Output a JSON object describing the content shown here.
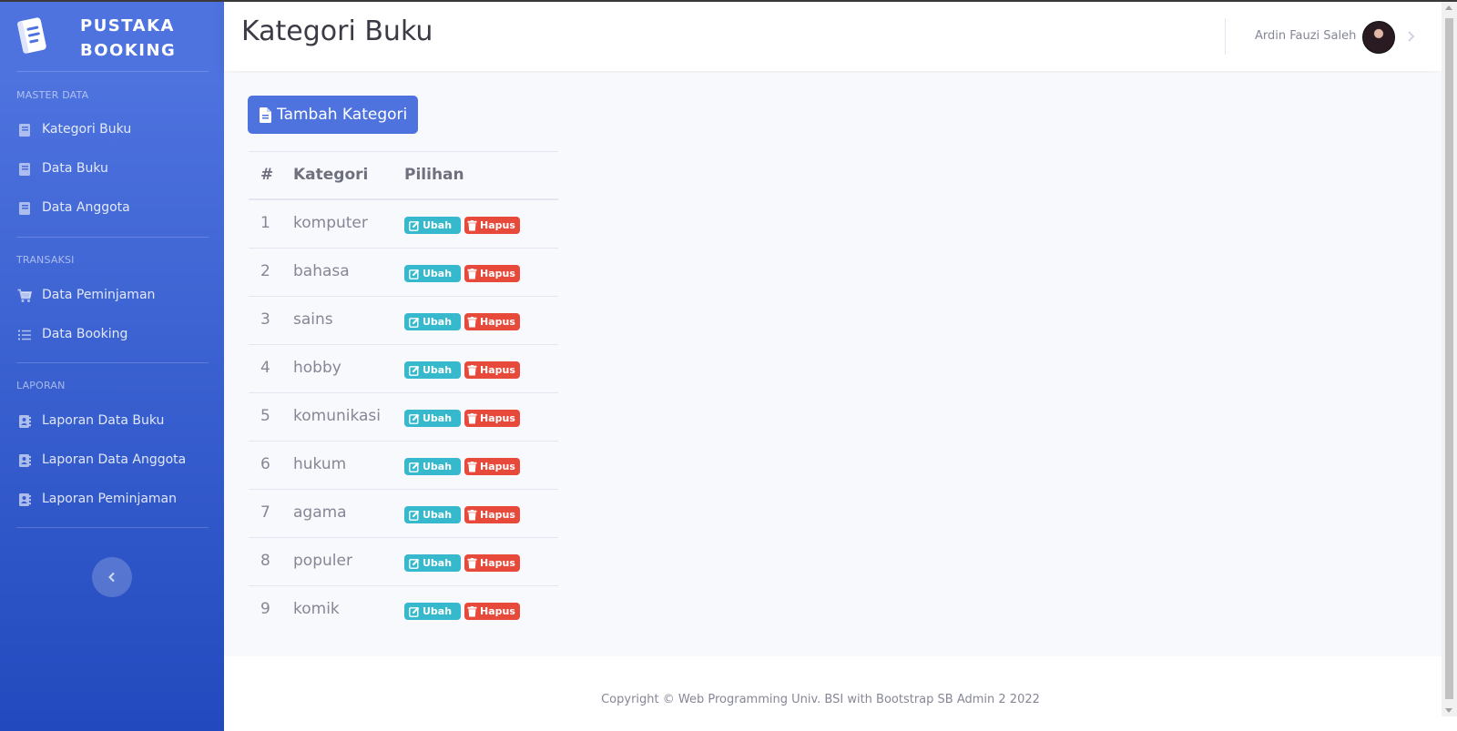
{
  "sidebar": {
    "brand": {
      "line1": "PUSTAKA",
      "line2": "BOOKING",
      "icon": "book-icon"
    },
    "sections": [
      {
        "heading": "MASTER DATA",
        "items": [
          {
            "label": "Kategori Buku",
            "icon": "book-icon"
          },
          {
            "label": "Data Buku",
            "icon": "book-icon"
          },
          {
            "label": "Data Anggota",
            "icon": "book-icon"
          }
        ]
      },
      {
        "heading": "TRANSAKSI",
        "items": [
          {
            "label": "Data Peminjaman",
            "icon": "shopping-cart-icon"
          },
          {
            "label": "Data Booking",
            "icon": "list-icon"
          }
        ]
      },
      {
        "heading": "LAPORAN",
        "items": [
          {
            "label": "Laporan Data Buku",
            "icon": "address-book-icon"
          },
          {
            "label": "Laporan Data Anggota",
            "icon": "address-book-icon"
          },
          {
            "label": "Laporan Peminjaman",
            "icon": "address-book-icon"
          }
        ]
      }
    ],
    "toggle_icon": "chevron-left-icon"
  },
  "topbar": {
    "title": "Kategori Buku",
    "user_name": "Ardin Fauzi Saleh",
    "avatar_icon": "user-avatar",
    "caret_icon": "chevron-right-icon"
  },
  "main": {
    "add_button": {
      "label": "Tambah Kategori",
      "icon": "file-icon"
    },
    "table": {
      "headers": [
        "#",
        "Kategori",
        "Pilihan"
      ],
      "rows": [
        {
          "no": "1",
          "kategori": "komputer"
        },
        {
          "no": "2",
          "kategori": "bahasa"
        },
        {
          "no": "3",
          "kategori": "sains"
        },
        {
          "no": "4",
          "kategori": "hobby"
        },
        {
          "no": "5",
          "kategori": "komunikasi"
        },
        {
          "no": "6",
          "kategori": "hukum"
        },
        {
          "no": "7",
          "kategori": "agama"
        },
        {
          "no": "8",
          "kategori": "populer"
        },
        {
          "no": "9",
          "kategori": "komik"
        }
      ],
      "edit_label": "Ubah",
      "delete_label": "Hapus",
      "edit_icon": "edit-icon",
      "delete_icon": "trash-icon"
    }
  },
  "footer": {
    "copyright": "Copyright © Web Programming Univ. BSI with Bootstrap SB Admin 2 2022"
  },
  "colors": {
    "primary": "#4e73df",
    "info": "#36b9cc",
    "danger": "#e74a3b",
    "content_bg": "#f8f9fc"
  }
}
